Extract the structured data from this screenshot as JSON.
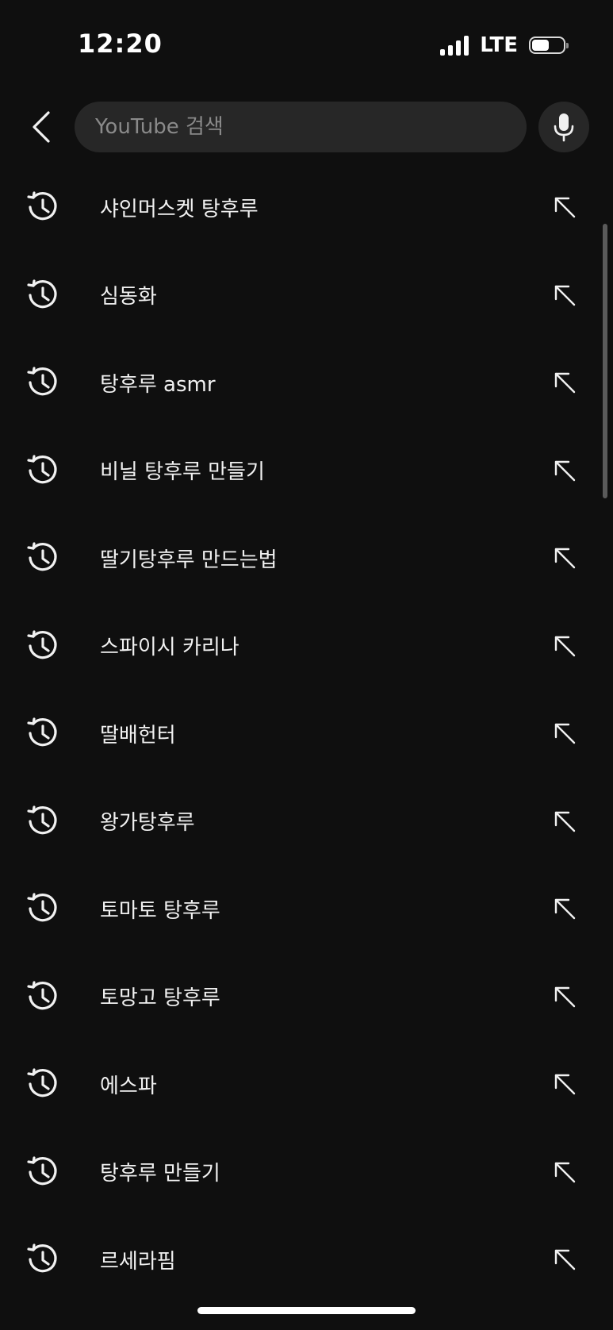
{
  "status_bar": {
    "time": "12:20",
    "network": "LTE",
    "battery_level": 0.55
  },
  "search": {
    "placeholder": "YouTube 검색",
    "value": ""
  },
  "icons": {
    "back": "back-arrow-icon",
    "mic": "microphone-icon",
    "history": "history-icon",
    "fill": "arrow-up-left-icon"
  },
  "suggestions": [
    "샤인머스켓 탕후루",
    "심동화",
    "탕후루 asmr",
    "비닐 탕후루 만들기",
    "딸기탕후루 만드는법",
    "스파이시 카리나",
    "딸배헌터",
    "왕가탕후루",
    "토마토 탕후루",
    "토망고 탕후루",
    "에스파",
    "탕후루 만들기",
    "르세라핌"
  ],
  "colors": {
    "background": "#0f0f0f",
    "search_box": "#272727",
    "text": "#f1f1f1",
    "placeholder": "#8a8a8a"
  }
}
